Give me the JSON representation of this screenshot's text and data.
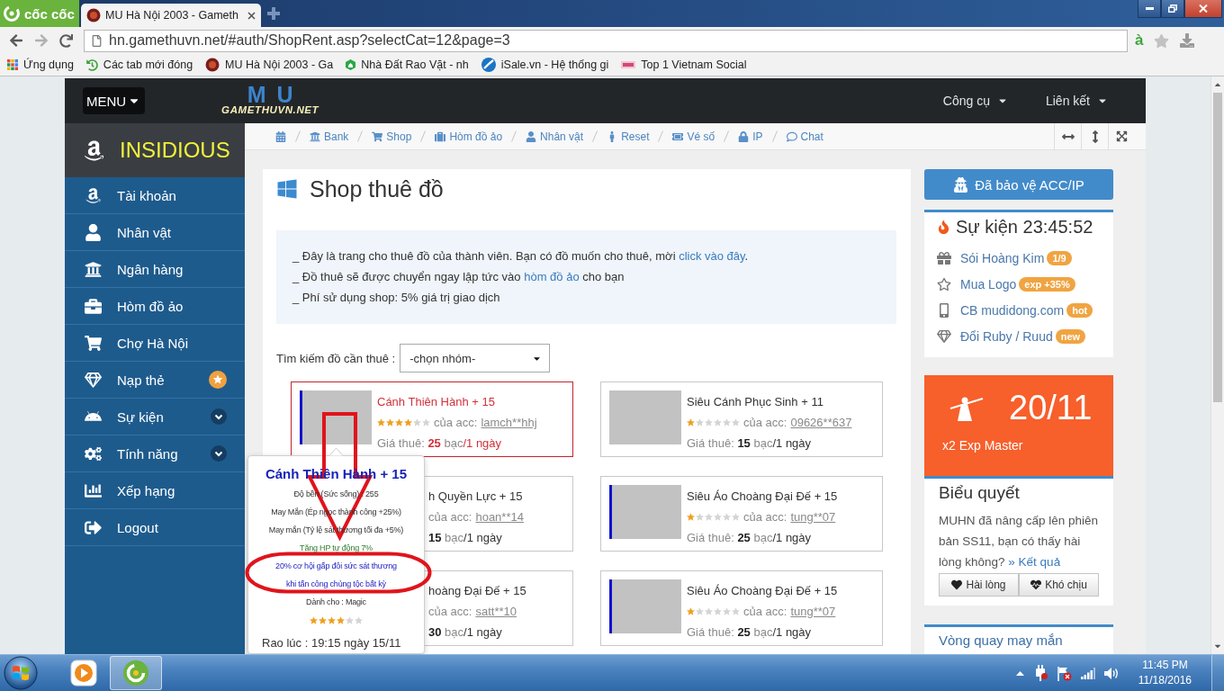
{
  "browser": {
    "brand": "cốc cốc",
    "tabs": [
      {
        "title": "MU Hà Nội 2003 - Gameth",
        "selected": true
      }
    ],
    "address": "hn.gamethuvn.net/#auth/ShopRent.asp?selectCat=12&page=3",
    "input_mode": "à",
    "bookmarks": [
      {
        "kind": "apps",
        "label": "Ứng dụng"
      },
      {
        "kind": "history",
        "label": "Các tab mới đóng"
      },
      {
        "kind": "game",
        "label": "MU Hà Nội 2003 - Ga"
      },
      {
        "kind": "house",
        "label": "Nhà Đất Rao Vặt - nh"
      },
      {
        "kind": "globe",
        "label": "iSale.vn - Hệ thống gi"
      },
      {
        "kind": "banner",
        "label": "Top 1 Vietnam Social"
      }
    ]
  },
  "header": {
    "menu_button": "MENU",
    "logo": {
      "mark": "MU",
      "text": "GAMETHUVN.NET"
    },
    "nav": [
      {
        "label": "Công cụ"
      },
      {
        "label": "Liên kết"
      }
    ]
  },
  "sidebar": {
    "user": "INSIDIOUS",
    "items": [
      {
        "kind": "account",
        "label": "Tài khoản",
        "star_badge": false,
        "submenu": false
      },
      {
        "kind": "character",
        "label": "Nhân vật",
        "star_badge": false,
        "submenu": false
      },
      {
        "kind": "bank",
        "label": "Ngân hàng",
        "star_badge": false,
        "submenu": false
      },
      {
        "kind": "storage",
        "label": "Hòm đồ ảo",
        "star_badge": false,
        "submenu": false
      },
      {
        "kind": "market",
        "label": "Chợ Hà Nội",
        "star_badge": false,
        "submenu": false
      },
      {
        "kind": "topup",
        "label": "Nạp thẻ",
        "star_badge": true,
        "submenu": false
      },
      {
        "kind": "event",
        "label": "Sự kiện",
        "star_badge": false,
        "submenu": true
      },
      {
        "kind": "features",
        "label": "Tính năng",
        "star_badge": false,
        "submenu": true
      },
      {
        "kind": "ranking",
        "label": "Xếp hạng",
        "star_badge": false,
        "submenu": false
      },
      {
        "kind": "logout",
        "label": "Logout",
        "star_badge": false,
        "submenu": false
      }
    ]
  },
  "breadcrumb": [
    {
      "kind": "calendar"
    },
    {
      "kind": "bank",
      "label": "Bank"
    },
    {
      "kind": "shop",
      "label": "Shop"
    },
    {
      "kind": "storage",
      "label": "Hòm đồ ảo"
    },
    {
      "kind": "character",
      "label": "Nhân vật"
    },
    {
      "kind": "reset",
      "label": "Reset"
    },
    {
      "kind": "lottery",
      "label": "Vé số"
    },
    {
      "kind": "ip",
      "label": "IP"
    },
    {
      "kind": "chat",
      "label": "Chat"
    }
  ],
  "shop": {
    "title": "Shop thuê đồ",
    "notice": [
      {
        "text": "_ Đây là trang cho thuê đồ của thành viên. Bạn có đồ muốn cho thuê, mời ",
        "link": "click vào đây",
        "after": "."
      },
      {
        "text": "_ Đồ thuê sẽ được chuyển ngay lập tức vào ",
        "link": "hòm đồ ảo",
        "after": " cho bạn"
      },
      {
        "text": "_ Phí sử dụng shop: 5% giá trị giao dịch"
      }
    ],
    "search": {
      "label": "Tìm kiếm đồ cần thuê :",
      "value": "-chọn nhóm-"
    },
    "items": [
      {
        "kind": "full",
        "selected": true,
        "highlight_bar": true,
        "name": "Cánh Thiên Hành + 15",
        "stars": 4,
        "owner_label": "của acc:",
        "owner": "lamch**hhj",
        "price_label": "Giá thuê:",
        "price": "25",
        "unit": "bạc",
        "period": "/1 ngày"
      },
      {
        "kind": "full",
        "selected": false,
        "highlight_bar": false,
        "name": "Siêu Cánh Phục Sinh + 11",
        "stars": 1,
        "owner_label": "của acc:",
        "owner": "09626**637",
        "price_label": "Giá thuê:",
        "price": "15",
        "unit": "bạc",
        "period": "/1 ngày"
      },
      {
        "kind": "covered",
        "selected": false,
        "name": "h Quyền Lực + 15",
        "owner_label": "của acc:",
        "owner": "hoan**14",
        "price": "15",
        "unit": "bạc",
        "period": "/1 ngày"
      },
      {
        "kind": "full",
        "selected": false,
        "highlight_bar": true,
        "name": "Siêu Áo Choàng Đại Đế + 15",
        "stars": 1,
        "owner_label": "của acc:",
        "owner": "tung**07",
        "price_label": "Giá thuê:",
        "price": "25",
        "unit": "bạc",
        "period": "/1 ngày"
      },
      {
        "kind": "covered",
        "selected": false,
        "name": "hoàng Đại Đế + 15",
        "owner_label": "của acc:",
        "owner": "satt**10",
        "price": "30",
        "unit": "bạc",
        "period": "/1 ngày"
      },
      {
        "kind": "full",
        "selected": false,
        "highlight_bar": true,
        "name": "Siêu Áo Choàng Đại Đế + 15",
        "stars": 1,
        "owner_label": "của acc:",
        "owner": "tung**07",
        "price_label": "Giá thuê:",
        "price": "25",
        "unit": "bạc",
        "period": "/1 ngày"
      }
    ],
    "tooltip": {
      "title": "Cánh Thiên Hành + 15",
      "lines": [
        {
          "kind": "basic",
          "text": "Độ bền (Sức sống) : 255"
        },
        {
          "kind": "basic",
          "text": "May Mắn (Ép ngọc thành công +25%)"
        },
        {
          "kind": "basic",
          "text": "May mắn (Tỷ lệ sát thương tối đa +5%)"
        },
        {
          "kind": "option",
          "text": "Tăng HP tự động 7%"
        },
        {
          "kind": "excellent",
          "text": "20% cơ hội gấp đôi sức sát thương"
        },
        {
          "kind": "excellent",
          "text": "khi tấn công chủng tộc bất kỳ"
        },
        {
          "kind": "basic",
          "text": "Dành cho : Magic"
        }
      ],
      "stars": 4,
      "posted": "Rao lúc : 19:15 ngày 15/11"
    }
  },
  "side_panel": {
    "protect_button": "Đã bảo vệ ACC/IP",
    "event": {
      "title": "Sự kiện 23:45:52",
      "links": [
        {
          "kind": "gift",
          "label": "Sói Hoàng Kim",
          "badge": "1/9"
        },
        {
          "kind": "star",
          "label": "Mua Logo",
          "badge": "exp +35%"
        },
        {
          "kind": "mobile",
          "label": "CB mudidong.com",
          "badge": "hot"
        },
        {
          "kind": "gem",
          "label": "Đổi Ruby / Ruud",
          "badge": "new"
        }
      ]
    },
    "promo": {
      "date": "20/11",
      "caption": "x2 Exp Master"
    },
    "poll": {
      "title": "Biểu quyết",
      "question": "MUHN đã nâng cấp lên phiên bản SS11, bạn có thấy hài lòng không?",
      "result_link": "» Kết quả",
      "options": [
        {
          "kind": "heart",
          "label": "Hài lòng"
        },
        {
          "kind": "heartbeat",
          "label": "Khó chịu"
        }
      ]
    },
    "wheel": {
      "title": "Vòng quay may mắn"
    }
  },
  "taskbar": {
    "apps": [
      {
        "kind": "media",
        "selected": false
      },
      {
        "kind": "browser",
        "selected": true
      }
    ],
    "clock": {
      "time": "11:45 PM",
      "date": "11/18/2016"
    }
  }
}
